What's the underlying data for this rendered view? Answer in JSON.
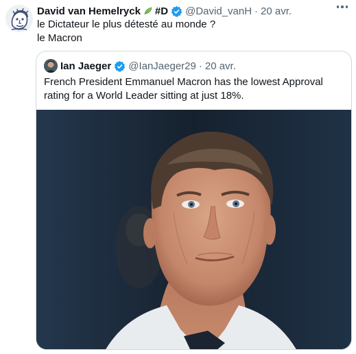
{
  "tweet": {
    "author_name": "David van Hemelryck",
    "hashtag": "#D",
    "handle": "@David_vanH",
    "separator": "·",
    "time": "20 avr.",
    "lines": [
      "le Dictateur le plus détesté au monde ?",
      "le Macron"
    ]
  },
  "quoted": {
    "author_name": "Ian Jaeger",
    "handle": "@IanJaeger29",
    "separator": "·",
    "time": "20 avr.",
    "text": "French President Emmanuel Macron has the lowest Approval rating for a World Leader sitting at just 18%."
  },
  "icons": {
    "avatar": "cartoon-portrait-avatar",
    "leaf": "leaf-icon",
    "verified": "verified-badge-icon",
    "more": "more-options-icon"
  },
  "colors": {
    "verified_blue": "#1d9bf0",
    "secondary_text": "#536471",
    "border": "#cfd9de",
    "leaf_green": "#8cc36a"
  }
}
